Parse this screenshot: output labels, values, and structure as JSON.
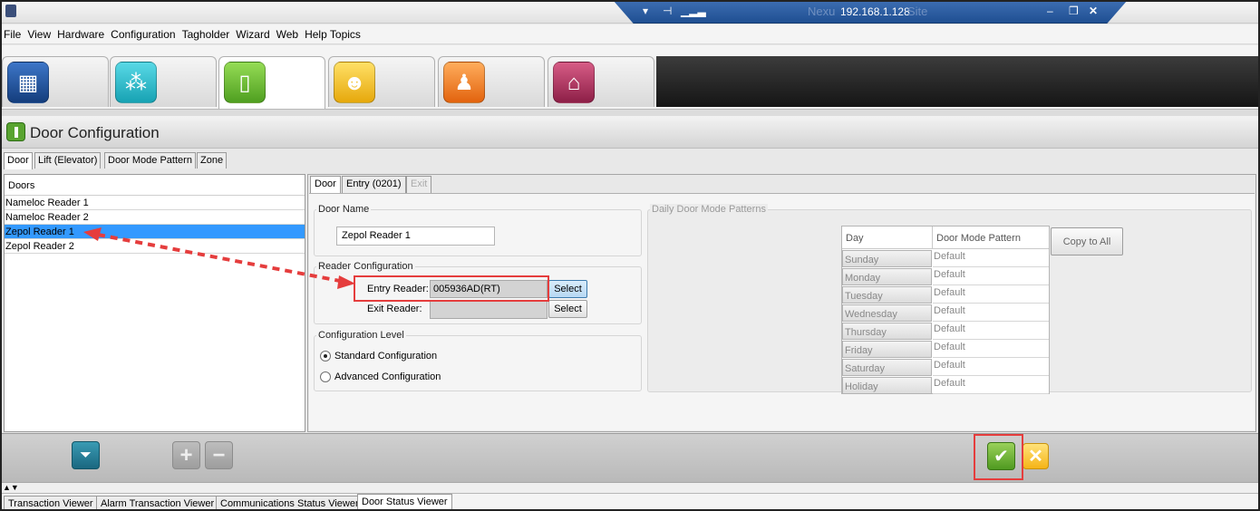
{
  "rdp_bar": {
    "ghost_text": "Nexu",
    "ip": "192.168.1.128",
    "ghost_suffix": "Site"
  },
  "menu": [
    "File",
    "View",
    "Hardware",
    "Configuration",
    "Tagholder",
    "Wizard",
    "Web",
    "Help Topics"
  ],
  "module_tabs": [
    {
      "icon": "system-grid-icon",
      "color": "#1d4f98"
    },
    {
      "icon": "network-icon",
      "color": "#23b8c8"
    },
    {
      "icon": "door-icon",
      "color": "#6ac13a"
    },
    {
      "icon": "users-icon",
      "color": "#f2c21a"
    },
    {
      "icon": "person-card-icon",
      "color": "#f07a1a"
    },
    {
      "icon": "home-key-icon",
      "color": "#b2305f"
    }
  ],
  "header": {
    "title": "Door Configuration"
  },
  "sub_tabs": [
    "Door",
    "Lift (Elevator)",
    "Door Mode Pattern",
    "Zone"
  ],
  "doors": {
    "header": "Doors",
    "items": [
      "Nameloc Reader 1",
      "Nameloc Reader 2",
      "Zepol Reader 1",
      "Zepol Reader 2"
    ],
    "selected": "Zepol Reader 1"
  },
  "inner_tabs": [
    "Door",
    "Entry (0201)",
    "Exit"
  ],
  "door_name": {
    "title": "Door Name",
    "value": "Zepol Reader 1"
  },
  "reader_config": {
    "title": "Reader Configuration",
    "entry_label": "Entry Reader:",
    "entry_value": "005936AD(RT)",
    "exit_label": "Exit Reader:",
    "exit_value": "",
    "select_label": "Select"
  },
  "config_level": {
    "title": "Configuration Level",
    "options": [
      "Standard Configuration",
      "Advanced Configuration"
    ],
    "selected": "Standard Configuration"
  },
  "daily_patterns": {
    "title": "Daily Door Mode Patterns",
    "col_day": "Day",
    "col_pattern": "Door Mode Pattern",
    "copy_label": "Copy to All",
    "rows": [
      {
        "day": "Sunday",
        "pattern": "Default"
      },
      {
        "day": "Monday",
        "pattern": "Default"
      },
      {
        "day": "Tuesday",
        "pattern": "Default"
      },
      {
        "day": "Wednesday",
        "pattern": "Default"
      },
      {
        "day": "Thursday",
        "pattern": "Default"
      },
      {
        "day": "Friday",
        "pattern": "Default"
      },
      {
        "day": "Saturday",
        "pattern": "Default"
      },
      {
        "day": "Holiday",
        "pattern": "Default"
      }
    ]
  },
  "status_tabs": [
    "Transaction Viewer",
    "Alarm Transaction Viewer",
    "Communications Status Viewer",
    "Door Status Viewer"
  ],
  "colors": {
    "selection": "#3399ff",
    "annotation": "#e53d3d"
  }
}
